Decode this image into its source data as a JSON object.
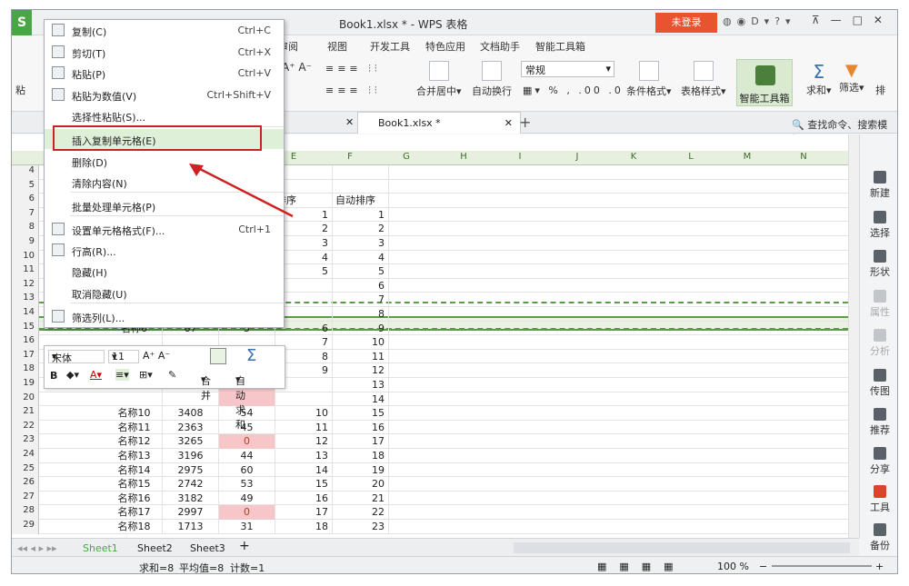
{
  "window": {
    "title": "Book1.xlsx * - WPS 表格",
    "login": "未登录",
    "logo": "S"
  },
  "menubar": [
    "审阅",
    "视图",
    "开发工具",
    "特色应用",
    "文档助手",
    "智能工具箱"
  ],
  "ribbon": {
    "paste": "粘",
    "merge": "合并居中",
    "wrap": "自动换行",
    "number_format": "常规",
    "cond_format": "条件格式",
    "table_style": "表格样式",
    "smart_tools": "智能工具箱",
    "sum": "求和",
    "filter": "筛选",
    "sort": "排"
  },
  "tabbar": {
    "doc_tab": "Book1.xlsx *",
    "search": "查找命令、搜索模板"
  },
  "columns": [
    "E",
    "F",
    "G",
    "H",
    "I",
    "J",
    "K",
    "L",
    "M",
    "N"
  ],
  "rows": [
    {
      "n": "4",
      "a": "",
      "b": "",
      "c": "",
      "e": "",
      "f": ""
    },
    {
      "n": "5",
      "a": "",
      "b": "",
      "c": "",
      "e": "",
      "f": ""
    },
    {
      "n": "6",
      "a": "",
      "b": "",
      "c": "",
      "e": "排序",
      "f": "自动排序"
    },
    {
      "n": "7",
      "a": "",
      "b": "",
      "c": "",
      "e": "1",
      "f": "1"
    },
    {
      "n": "8",
      "a": "",
      "b": "",
      "c": "",
      "e": "2",
      "f": "2"
    },
    {
      "n": "9",
      "a": "",
      "b": "",
      "c": "",
      "e": "3",
      "f": "3"
    },
    {
      "n": "10",
      "a": "",
      "b": "",
      "c": "",
      "e": "4",
      "f": "4"
    },
    {
      "n": "11",
      "a": "",
      "b": "",
      "c": "",
      "e": "5",
      "f": "5"
    },
    {
      "n": "12",
      "a": "",
      "b": "",
      "c": "",
      "e": "",
      "f": "6"
    },
    {
      "n": "13",
      "a": "",
      "b": "",
      "c": "",
      "e": "",
      "f": "7"
    },
    {
      "n": "14",
      "a": "",
      "b": "",
      "c": "",
      "e": "",
      "f": "8"
    },
    {
      "n": "15",
      "a": "名称6",
      "b": "67",
      "c": "5",
      "e": "6",
      "f": "9"
    },
    {
      "n": "16",
      "a": "",
      "b": "",
      "c": "",
      "e": "7",
      "f": "10"
    },
    {
      "n": "17",
      "a": "",
      "b": "",
      "c": "",
      "e": "8",
      "f": "11"
    },
    {
      "n": "18",
      "a": "",
      "b": "",
      "c": "",
      "e": "9",
      "f": "12"
    },
    {
      "n": "19",
      "a": "",
      "b": "",
      "c": "",
      "e": "",
      "f": "13"
    },
    {
      "n": "20",
      "a": "",
      "b": "",
      "c": "",
      "e": "",
      "f": "14"
    },
    {
      "n": "21",
      "a": "名称10",
      "b": "3408",
      "c": "54",
      "e": "10",
      "f": "15"
    },
    {
      "n": "22",
      "a": "名称11",
      "b": "2363",
      "c": "45",
      "e": "11",
      "f": "16"
    },
    {
      "n": "23",
      "a": "名称12",
      "b": "3265",
      "c": "0",
      "e": "12",
      "f": "17"
    },
    {
      "n": "24",
      "a": "名称13",
      "b": "3196",
      "c": "44",
      "e": "13",
      "f": "18"
    },
    {
      "n": "25",
      "a": "名称14",
      "b": "2975",
      "c": "60",
      "e": "14",
      "f": "19"
    },
    {
      "n": "26",
      "a": "名称15",
      "b": "2742",
      "c": "53",
      "e": "15",
      "f": "20"
    },
    {
      "n": "27",
      "a": "名称16",
      "b": "3182",
      "c": "49",
      "e": "16",
      "f": "21"
    },
    {
      "n": "28",
      "a": "名称17",
      "b": "2997",
      "c": "0",
      "e": "17",
      "f": "22"
    },
    {
      "n": "29",
      "a": "名称18",
      "b": "1713",
      "c": "31",
      "e": "18",
      "f": "23"
    }
  ],
  "context_menu": [
    {
      "label": "复制(C)",
      "shortcut": "Ctrl+C"
    },
    {
      "label": "剪切(T)",
      "shortcut": "Ctrl+X"
    },
    {
      "label": "粘贴(P)",
      "shortcut": "Ctrl+V"
    },
    {
      "label": "粘贴为数值(V)",
      "shortcut": "Ctrl+Shift+V"
    },
    {
      "label": "选择性粘贴(S)...",
      "shortcut": ""
    },
    {
      "label": "插入复制单元格(E)",
      "shortcut": ""
    },
    {
      "label": "删除(D)",
      "shortcut": ""
    },
    {
      "label": "清除内容(N)",
      "shortcut": ""
    },
    {
      "label": "批量处理单元格(P)",
      "shortcut": ""
    },
    {
      "label": "设置单元格格式(F)...",
      "shortcut": "Ctrl+1"
    },
    {
      "label": "行高(R)...",
      "shortcut": ""
    },
    {
      "label": "隐藏(H)",
      "shortcut": ""
    },
    {
      "label": "取消隐藏(U)",
      "shortcut": ""
    },
    {
      "label": "筛选列(L)...",
      "shortcut": ""
    }
  ],
  "mini_toolbar": {
    "font": "宋体",
    "size": "11",
    "merge": "合并",
    "autosum": "自动求和"
  },
  "side_panel": [
    "新建",
    "选择",
    "形状",
    "属性",
    "分析",
    "传图",
    "推荐",
    "分享",
    "工具",
    "备份"
  ],
  "sheets": [
    "Sheet1",
    "Sheet2",
    "Sheet3"
  ],
  "status": {
    "sum": "求和=8",
    "avg": "平均值=8",
    "count": "计数=1",
    "zoom": "100 %"
  },
  "colors": {
    "accent": "#4aa544",
    "highlight_box": "#cc2222",
    "login": "#e8542f"
  }
}
